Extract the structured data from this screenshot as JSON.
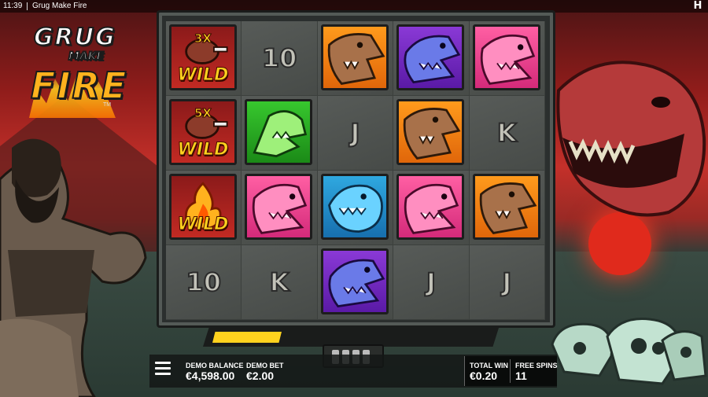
{
  "status_bar": {
    "time": "11:39",
    "app_title": "Grug Make Fire"
  },
  "logo": {
    "line1": "GRUG",
    "line2": "MAKE",
    "line3": "FIRE",
    "tm": "TM"
  },
  "grid": {
    "columns": [
      [
        {
          "type": "wild",
          "multiplier": "3X",
          "label": "WILD",
          "icon": "meat-icon"
        },
        {
          "type": "wild",
          "multiplier": "5X",
          "label": "WILD",
          "icon": "meat-icon"
        },
        {
          "type": "wild",
          "multiplier": "",
          "label": "WILD",
          "icon": "fire-icon"
        },
        {
          "type": "letter",
          "label": "10"
        }
      ],
      [
        {
          "type": "letter",
          "label": "10"
        },
        {
          "type": "dino",
          "color": "green",
          "icon": "green-dino-icon"
        },
        {
          "type": "dino",
          "color": "pink",
          "icon": "pink-trex-icon"
        },
        {
          "type": "letter",
          "label": "K"
        }
      ],
      [
        {
          "type": "dino",
          "color": "orange",
          "icon": "brown-beast-icon"
        },
        {
          "type": "letter",
          "label": "J"
        },
        {
          "type": "dino",
          "color": "blue",
          "icon": "blue-fish-icon"
        },
        {
          "type": "dino",
          "color": "purple",
          "icon": "purple-dino-icon"
        }
      ],
      [
        {
          "type": "dino",
          "color": "purple",
          "icon": "purple-dino-icon"
        },
        {
          "type": "dino",
          "color": "orange",
          "icon": "brown-beast-icon"
        },
        {
          "type": "dino",
          "color": "pink",
          "icon": "pink-trex-icon"
        },
        {
          "type": "letter",
          "label": "J"
        }
      ],
      [
        {
          "type": "dino",
          "color": "pink",
          "icon": "pink-trex-icon"
        },
        {
          "type": "letter",
          "label": "K"
        },
        {
          "type": "dino",
          "color": "orange",
          "icon": "brown-beast-icon"
        },
        {
          "type": "letter",
          "label": "J"
        }
      ]
    ]
  },
  "progress": {
    "fill_fraction": 0.25
  },
  "hud": {
    "balance_label": "DEMO BALANCE",
    "balance_value": "€4,598.00",
    "bet_label": "DEMO BET",
    "bet_value": "€2.00",
    "total_win_label": "TOTAL WIN",
    "total_win_value": "€0.20",
    "free_spins_label": "FREE SPINS",
    "free_spins_value": "11"
  },
  "colors": {
    "wild_text": "#ffd21e",
    "orange": "#ff9a1c",
    "purple": "#8a39d6",
    "pink": "#ff5fa3",
    "green": "#37c72e",
    "blue": "#2fa8e0",
    "progress_fill": "#ffd21e"
  }
}
